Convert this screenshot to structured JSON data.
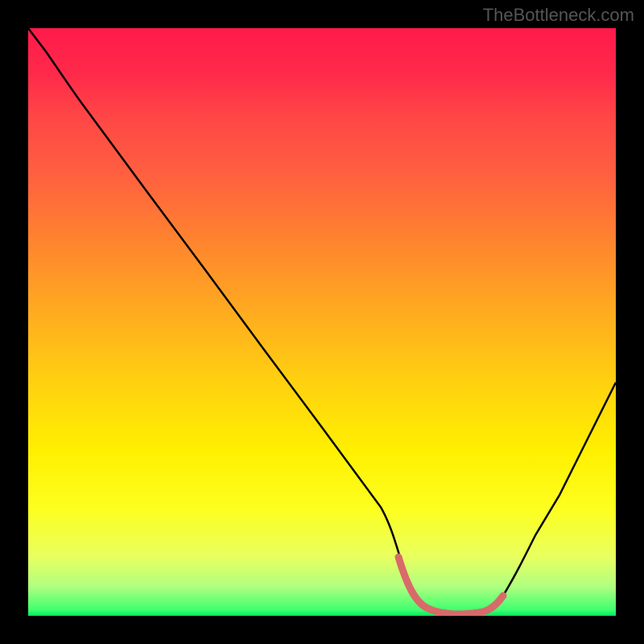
{
  "watermark": "TheBottleneck.com",
  "chart_data": {
    "type": "line",
    "title": "",
    "xlabel": "",
    "ylabel": "",
    "xlim": [
      0,
      100
    ],
    "ylim": [
      0,
      100
    ],
    "grid": false,
    "legend": false,
    "series": [
      {
        "name": "bottleneck-curve",
        "color": "#000000",
        "x": [
          0,
          3,
          10,
          20,
          30,
          40,
          50,
          60,
          63,
          66,
          70,
          74,
          78,
          80,
          85,
          90,
          95,
          100
        ],
        "y": [
          100,
          96,
          86,
          72.5,
          59,
          45.5,
          32,
          18,
          10,
          4,
          1,
          0,
          0,
          1,
          8,
          18,
          29,
          40
        ]
      },
      {
        "name": "optimal-range-highlight",
        "color": "#d86a6a",
        "x": [
          63,
          66,
          70,
          74,
          78,
          80
        ],
        "y": [
          10,
          4,
          1,
          0,
          0,
          1
        ]
      }
    ],
    "background_gradient": {
      "top": "#ff1a4a",
      "upper_mid": "#ffaa20",
      "mid": "#fff000",
      "lower_mid": "#e8ff60",
      "bottom": "#00e860"
    },
    "optimal_range_x": [
      63,
      80
    ]
  }
}
